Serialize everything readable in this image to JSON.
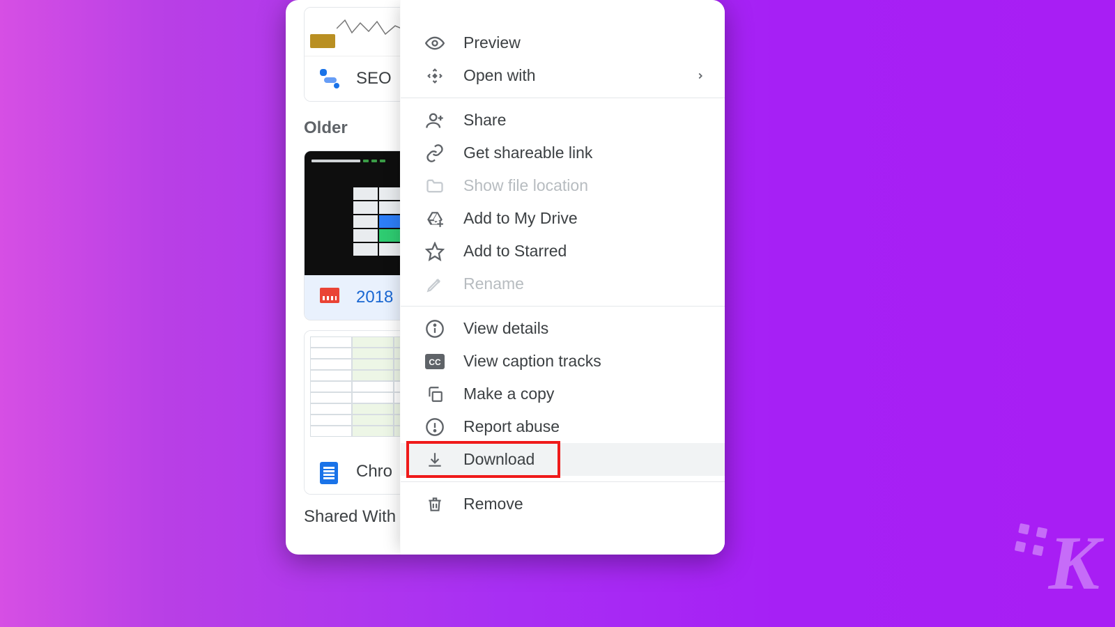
{
  "sections": {
    "older": "Older",
    "shared": "Shared With M"
  },
  "files": {
    "seo": {
      "name": "SEO"
    },
    "video": {
      "name": "2018"
    },
    "doc": {
      "name": "Chro"
    }
  },
  "menu": {
    "preview": "Preview",
    "open_with": "Open with",
    "share": "Share",
    "get_link": "Get shareable link",
    "show_location": "Show file location",
    "add_drive": "Add to My Drive",
    "add_starred": "Add to Starred",
    "rename": "Rename",
    "view_details": "View details",
    "captions": "View caption tracks",
    "make_copy": "Make a copy",
    "report_abuse": "Report abuse",
    "download": "Download",
    "remove": "Remove"
  }
}
